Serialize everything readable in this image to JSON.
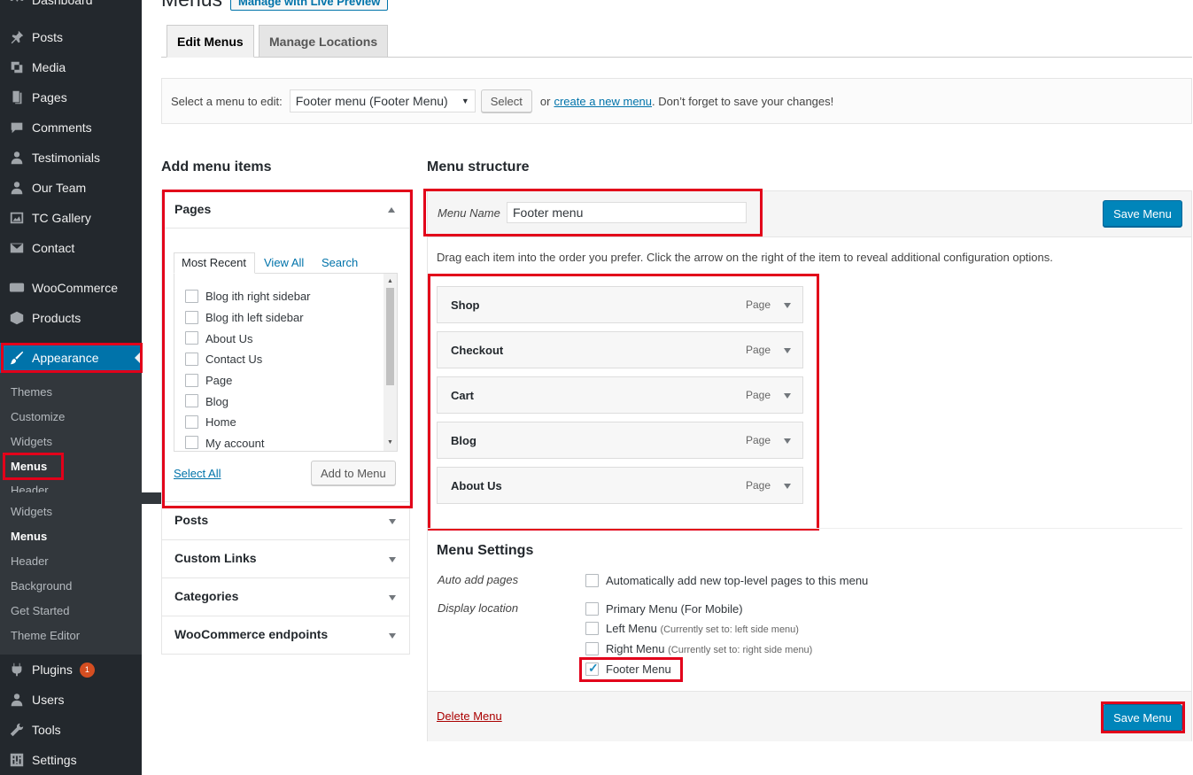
{
  "sidebar": {
    "items": [
      {
        "label": "Dashboard",
        "icon": "dashboard-icon"
      },
      {
        "label": "Posts",
        "icon": "pin-icon"
      },
      {
        "label": "Media",
        "icon": "media-icon"
      },
      {
        "label": "Pages",
        "icon": "pages-icon"
      },
      {
        "label": "Comments",
        "icon": "comment-icon"
      },
      {
        "label": "Testimonials",
        "icon": "person-icon"
      },
      {
        "label": "Our Team",
        "icon": "team-icon"
      },
      {
        "label": "TC Gallery",
        "icon": "gallery-icon"
      },
      {
        "label": "Contact",
        "icon": "mail-icon"
      },
      {
        "label": "WooCommerce",
        "icon": "woocommerce-icon"
      },
      {
        "label": "Products",
        "icon": "box-icon"
      },
      {
        "label": "Appearance",
        "icon": "brush-icon"
      },
      {
        "label": "Plugins",
        "icon": "plugin-icon",
        "badge": "1"
      },
      {
        "label": "Users",
        "icon": "user-icon"
      },
      {
        "label": "Tools",
        "icon": "wrench-icon"
      },
      {
        "label": "Settings",
        "icon": "settings-icon"
      }
    ],
    "appearance_sub": [
      "Themes",
      "Customize",
      "Widgets",
      "Menus",
      "Header"
    ],
    "flyout_sub": [
      "Widgets",
      "Menus",
      "Header",
      "Background",
      "Get Started",
      "Theme Editor"
    ]
  },
  "header": {
    "title": "Menus",
    "live_preview": "Manage with Live Preview",
    "tabs": [
      "Edit Menus",
      "Manage Locations"
    ]
  },
  "select_bar": {
    "label": "Select a menu to edit:",
    "selected": "Footer menu (Footer Menu)",
    "select_btn": "Select",
    "or": "or",
    "create_link": "create a new menu",
    "suffix": ". Don’t forget to save your changes!"
  },
  "add_items": {
    "heading": "Add menu items",
    "pages_title": "Pages",
    "inner_tabs": [
      "Most Recent",
      "View All",
      "Search"
    ],
    "pages": [
      "Blog ith right sidebar",
      "Blog ith left sidebar",
      "About Us",
      "Contact Us",
      "Page",
      "Blog",
      "Home",
      "My account"
    ],
    "select_all": "Select All",
    "add_to_menu": "Add to Menu",
    "other_sections": [
      "Posts",
      "Custom Links",
      "Categories",
      "WooCommerce endpoints"
    ]
  },
  "structure": {
    "heading": "Menu structure",
    "name_label": "Menu Name",
    "name_value": "Footer menu",
    "save": "Save Menu",
    "instructions": "Drag each item into the order you prefer. Click the arrow on the right of the item to reveal additional configuration options.",
    "items": [
      {
        "title": "Shop",
        "type": "Page"
      },
      {
        "title": "Checkout",
        "type": "Page"
      },
      {
        "title": "Cart",
        "type": "Page"
      },
      {
        "title": "Blog",
        "type": "Page"
      },
      {
        "title": "About Us",
        "type": "Page"
      }
    ],
    "settings_heading": "Menu Settings",
    "auto_add_label": "Auto add pages",
    "auto_add_text": "Automatically add new top-level pages to this menu",
    "display_label": "Display location",
    "locations": [
      {
        "name": "Primary Menu (For Mobile)",
        "note": "",
        "checked": false
      },
      {
        "name": "Left Menu",
        "note": "(Currently set to: left side menu)",
        "checked": false
      },
      {
        "name": "Right Menu",
        "note": "(Currently set to: right side menu)",
        "checked": false
      },
      {
        "name": "Footer Menu",
        "note": "",
        "checked": true
      }
    ],
    "delete": "Delete Menu"
  },
  "colors": {
    "accent": "#0073aa",
    "highlight": "#e2001a",
    "sidebar": "#23282d"
  }
}
